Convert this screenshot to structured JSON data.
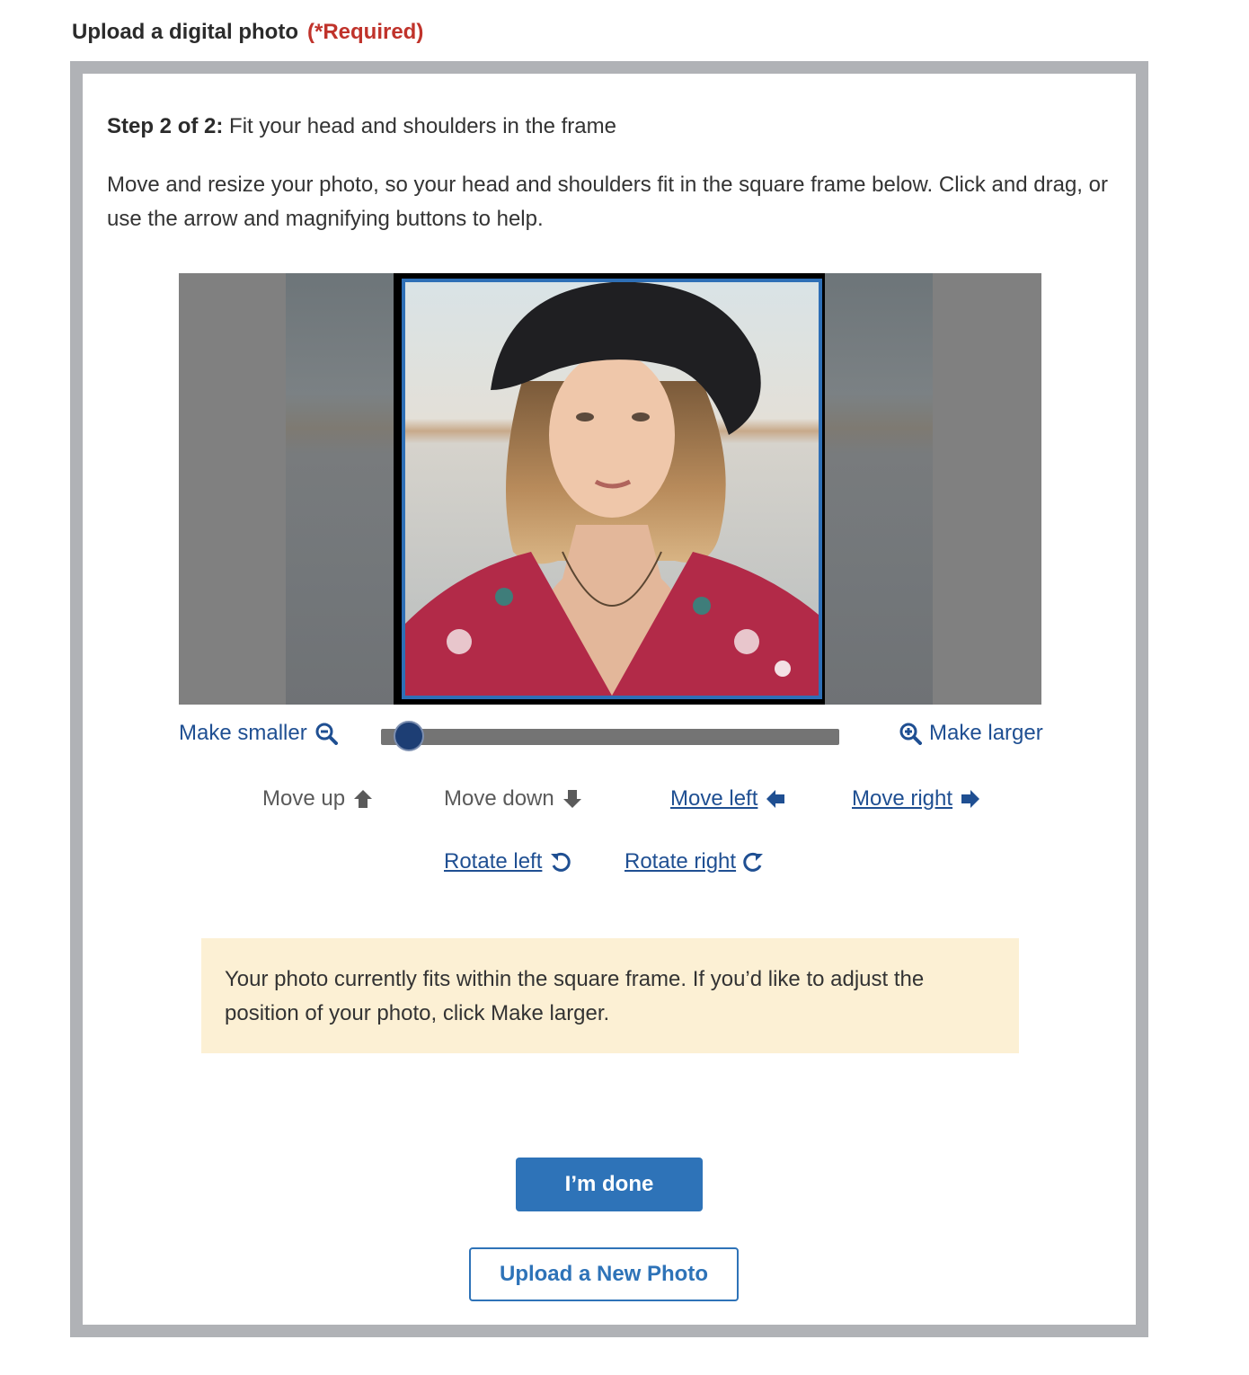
{
  "field": {
    "label": "Upload a digital photo",
    "required": "(*Required)"
  },
  "step": {
    "prefix": "Step 2 of 2:",
    "text": "Fit your head and shoulders in the frame"
  },
  "instructions": "Move and resize your photo, so your head and shoulders fit in the square frame below. Click and drag, or use the arrow and magnifying buttons to help.",
  "zoom": {
    "smaller_label": "Make smaller",
    "larger_label": "Make larger",
    "level": 0.03
  },
  "controls": {
    "move_up": "Move up",
    "move_down": "Move down",
    "move_left": "Move left",
    "move_right": "Move right",
    "rotate_left": "Rotate left",
    "rotate_right": "Rotate right"
  },
  "notice": "Your photo currently fits within the square frame. If you’d like to adjust the position of your photo, click Make larger.",
  "buttons": {
    "done": "I’m done",
    "upload_new": "Upload a New Photo"
  },
  "colors": {
    "link": "#1f4f92",
    "primary": "#2e73b8",
    "required": "#c0332b",
    "notice_bg": "#fcf0d4"
  }
}
